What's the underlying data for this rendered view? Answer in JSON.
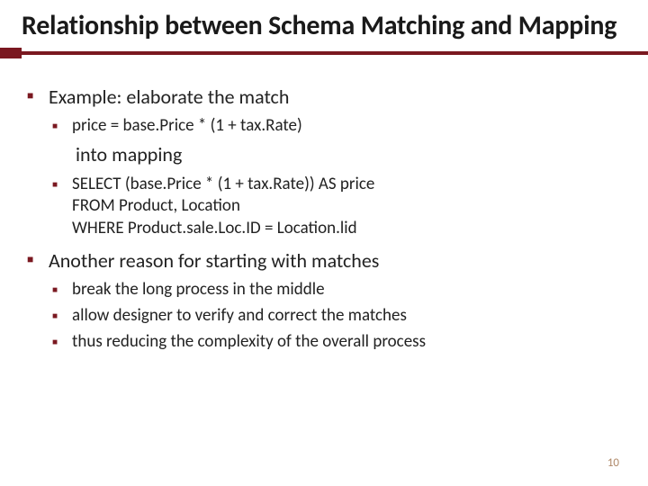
{
  "title": "Relationship between Schema Matching and Mapping",
  "bullets": {
    "b1": {
      "text": "Example: elaborate the match",
      "sub": {
        "s1": "price = base.Price * (1 + tax.Rate)"
      },
      "continuation": "into mapping",
      "sub2": {
        "s1_line1": "SELECT (base.Price * (1 + tax.Rate)) AS price",
        "s1_line2": "FROM Product, Location",
        "s1_line3": "WHERE Product.sale.Loc.ID = Location.lid"
      }
    },
    "b2": {
      "text": "Another reason for starting with matches",
      "sub": {
        "s1": "break the long process in the middle",
        "s2": "allow designer to verify and correct the matches",
        "s3": "thus reducing the complexity of the overall process"
      }
    }
  },
  "page_number": "10"
}
